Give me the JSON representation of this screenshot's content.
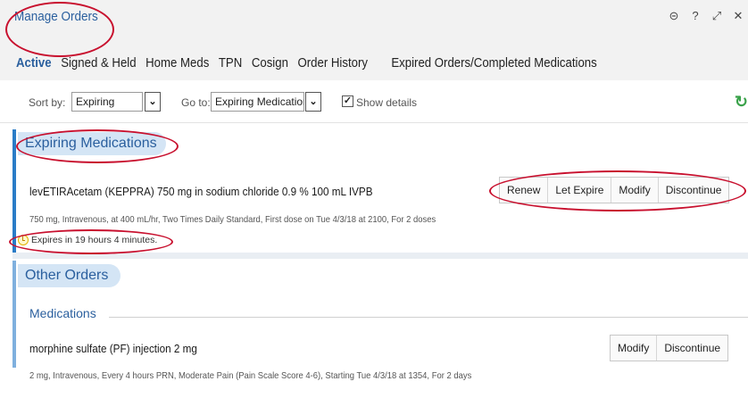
{
  "window": {
    "title": "Manage Orders",
    "icons": [
      "more-icon",
      "help-icon",
      "expand-icon",
      "close-icon"
    ]
  },
  "tabs": [
    {
      "label": "Active",
      "active": true
    },
    {
      "label": "Signed & Held"
    },
    {
      "label": "Home Meds"
    },
    {
      "label": "TPN"
    },
    {
      "label": "Cosign"
    },
    {
      "label": "Order History"
    },
    {
      "label": "Expired Orders/Completed Medications"
    }
  ],
  "toolbar": {
    "sort_label": "Sort by:",
    "sort_value": "Expiring",
    "goto_label": "Go to:",
    "goto_value": "Expiring Medications",
    "show_details_label": "Show details",
    "show_details_checked": true
  },
  "sections": {
    "expiring": {
      "heading": "Expiring Medications",
      "order": {
        "name": "levETIRAcetam (KEPPRA) 750 mg in sodium chloride 0.9 % 100 mL IVPB",
        "detail": "750 mg, Intravenous, at 400 mL/hr, Two Times Daily Standard, First dose on Tue 4/3/18 at 2100, For 2 doses",
        "expires": "Expires in 19 hours 4 minutes.",
        "actions": [
          "Renew",
          "Let Expire",
          "Modify",
          "Discontinue"
        ]
      }
    },
    "other": {
      "heading": "Other Orders",
      "subheading": "Medications",
      "order": {
        "name": "morphine sulfate (PF) injection 2 mg",
        "detail": "2 mg, Intravenous, Every 4 hours PRN, Moderate Pain (Pain Scale Score 4-6), Starting Tue 4/3/18 at 1354, For 2 days",
        "actions": [
          "Modify",
          "Discontinue"
        ]
      }
    }
  },
  "colors": {
    "accent": "#2a5f9e",
    "section_fill": "#d4e5f5",
    "annotation": "#c8102e",
    "refresh": "#3aa24a"
  }
}
